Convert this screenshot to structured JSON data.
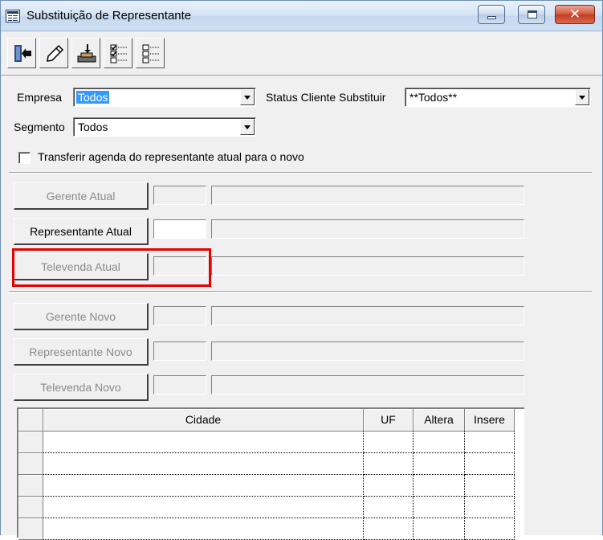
{
  "window": {
    "title": "Substituição de Representante",
    "minimize_icon": "minimize-icon",
    "maximize_icon": "maximize-icon",
    "close_label": "✕"
  },
  "toolbar": {
    "items": [
      {
        "name": "exit-button",
        "icon": "exit-door-icon"
      },
      {
        "name": "edit-button",
        "icon": "pencil-icon"
      },
      {
        "name": "confirm-button",
        "icon": "tray-arrow-icon"
      },
      {
        "name": "check-list-button",
        "icon": "checklist-icon"
      },
      {
        "name": "uncheck-list-button",
        "icon": "empty-list-icon"
      }
    ]
  },
  "filters": {
    "empresa_label": "Empresa",
    "empresa_value": "Todos",
    "status_label": "Status Cliente Substituir",
    "status_value": "**Todos**",
    "segmento_label": "Segmento",
    "segmento_value": "Todos",
    "transfer_label": "Transferir agenda do representante atual para o novo"
  },
  "atual": {
    "gerente_label": "Gerente Atual",
    "representante_label": "Representante Atual",
    "televenda_label": "Televenda Atual"
  },
  "novo": {
    "gerente_label": "Gerente Novo",
    "representante_label": "Representante Novo",
    "televenda_label": "Televenda Novo"
  },
  "grid": {
    "columns": [
      "Cidade",
      "UF",
      "Altera",
      "Insere"
    ],
    "row_count": 5
  },
  "colors": {
    "highlight": "#e60000",
    "selection": "#3399ff"
  }
}
